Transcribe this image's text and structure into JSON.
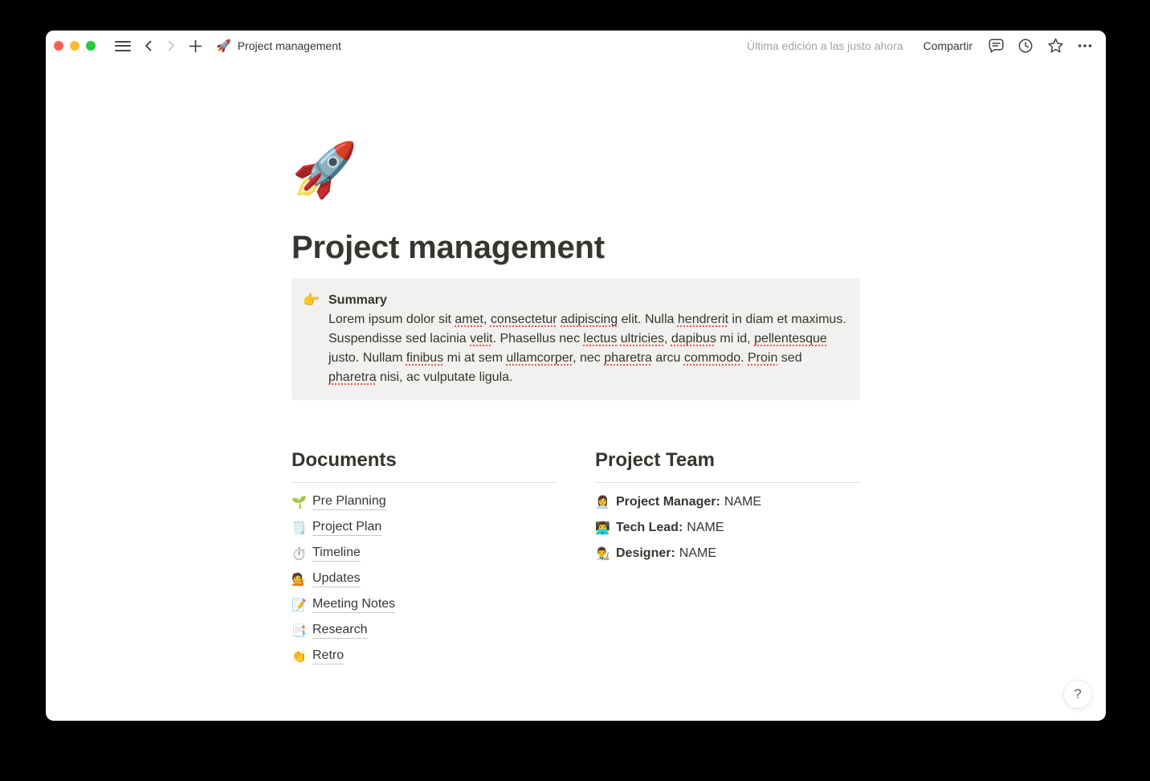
{
  "colors": {
    "tl-red": "#ff5f57",
    "tl-yellow": "#febc2e",
    "tl-green": "#28c840",
    "text-primary": "#37352f",
    "text-secondary": "#a5a29b",
    "callout-bg": "#f1f1ef",
    "divider": "#e0dfdc",
    "link-underline": "#c9c7c2",
    "spell-red": "#f0544c"
  },
  "titlebar": {
    "doc_icon": "🚀",
    "doc_title": "Project management",
    "last_edited": "Última edición a las justo ahora",
    "share_label": "Compartir",
    "action_icons": [
      "hamburger-menu",
      "back-chevron",
      "forward-chevron",
      "plus",
      "comments",
      "history-clock",
      "favorite-star",
      "more-ellipsis"
    ]
  },
  "page": {
    "icon": "🚀",
    "title": "Project management",
    "callout": {
      "icon": "👉",
      "heading": "Summary",
      "segments": [
        {
          "t": "Lorem ipsum dolor sit "
        },
        {
          "t": "amet",
          "sp": true
        },
        {
          "t": ", "
        },
        {
          "t": "consectetur",
          "sp": true
        },
        {
          "t": " "
        },
        {
          "t": "adipiscing",
          "sp": true
        },
        {
          "t": " elit. Nulla "
        },
        {
          "t": "hendrerit",
          "sp": true
        },
        {
          "t": " in diam et maximus. Suspendisse sed lacinia "
        },
        {
          "t": "velit",
          "sp": true
        },
        {
          "t": ". Phasellus nec "
        },
        {
          "t": "lectus",
          "sp": true
        },
        {
          "t": " "
        },
        {
          "t": "ultricies",
          "sp": true
        },
        {
          "t": ", "
        },
        {
          "t": "dapibus",
          "sp": true
        },
        {
          "t": " mi id, "
        },
        {
          "t": "pellentesque",
          "sp": true
        },
        {
          "t": " justo. Nullam "
        },
        {
          "t": "finibus",
          "sp": true
        },
        {
          "t": " mi at sem "
        },
        {
          "t": "ullamcorper",
          "sp": true
        },
        {
          "t": ", nec "
        },
        {
          "t": "pharetra",
          "sp": true
        },
        {
          "t": " arcu "
        },
        {
          "t": "commodo",
          "sp": true
        },
        {
          "t": ". "
        },
        {
          "t": "Proin",
          "sp": true
        },
        {
          "t": " sed "
        },
        {
          "t": "pharetra",
          "sp": true
        },
        {
          "t": " nisi, ac vulputate ligula."
        }
      ]
    },
    "documents": {
      "heading": "Documents",
      "items": [
        {
          "icon": "🌱",
          "label": "Pre Planning"
        },
        {
          "icon": "🗒️",
          "label": "Project Plan"
        },
        {
          "icon": "⏱️",
          "label": "Timeline"
        },
        {
          "icon": "💁",
          "label": "Updates"
        },
        {
          "icon": "📝",
          "label": "Meeting Notes"
        },
        {
          "icon": "📑",
          "label": "Research"
        },
        {
          "icon": "👏",
          "label": "Retro"
        }
      ]
    },
    "team": {
      "heading": "Project Team",
      "members": [
        {
          "icon": "👩‍💼",
          "role": "Project Manager:",
          "name": "NAME"
        },
        {
          "icon": "👨‍💻",
          "role": "Tech Lead:",
          "name": "NAME"
        },
        {
          "icon": "👨‍🎨",
          "role": "Designer:",
          "name": "NAME"
        }
      ]
    },
    "help_label": "?"
  }
}
